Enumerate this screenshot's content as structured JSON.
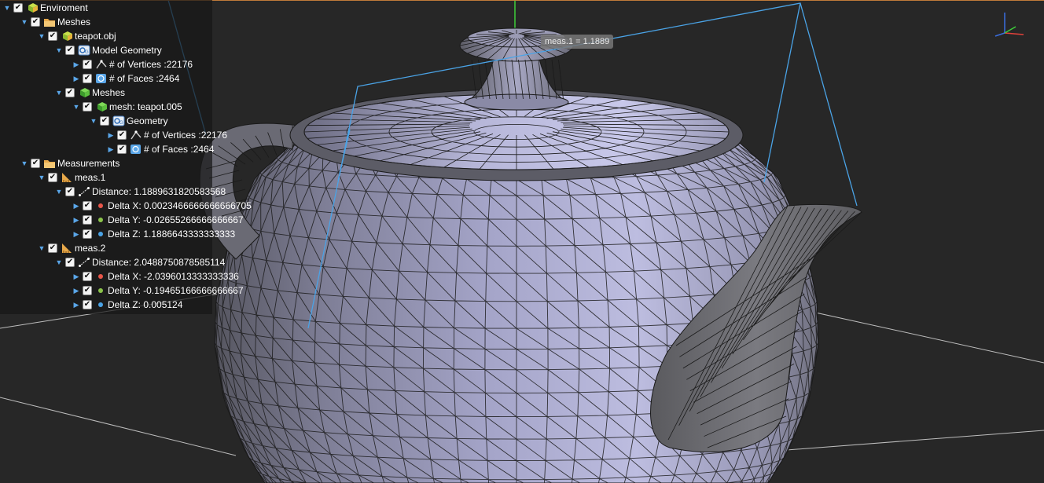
{
  "tree": {
    "items": [
      {
        "label": "Enviroment",
        "icon": "scene-cube-icon",
        "arrow": "open",
        "depth": 0
      },
      {
        "label": "Meshes",
        "icon": "folder-icon",
        "arrow": "open",
        "depth": 1
      },
      {
        "label": "teapot.obj",
        "icon": "scene-cube-icon",
        "arrow": "open",
        "depth": 2
      },
      {
        "label": "Model Geometry",
        "icon": "geometry-icon",
        "arrow": "open",
        "depth": 3
      },
      {
        "label": "# of Vertices :22176",
        "icon": "vertex-icon",
        "arrow": "closed",
        "depth": 4
      },
      {
        "label": "# of Faces :2464",
        "icon": "face-icon",
        "arrow": "closed",
        "depth": 4
      },
      {
        "label": "Meshes",
        "icon": "green-cube-icon",
        "arrow": "open",
        "depth": 3
      },
      {
        "label": "mesh: teapot.005",
        "icon": "green-cube-icon",
        "arrow": "open",
        "depth": 4
      },
      {
        "label": "Geometry",
        "icon": "geometry-icon",
        "arrow": "open",
        "depth": 5
      },
      {
        "label": "# of Vertices :22176",
        "icon": "vertex-icon",
        "arrow": "closed",
        "depth": 6
      },
      {
        "label": "# of Faces :2464",
        "icon": "face-icon",
        "arrow": "closed",
        "depth": 6
      },
      {
        "label": "Measurements",
        "icon": "folder-icon",
        "arrow": "open",
        "depth": 1
      },
      {
        "label": "meas.1",
        "icon": "ruler-icon",
        "arrow": "open",
        "depth": 2
      },
      {
        "label": "Distance: 1.1889631820583568",
        "icon": "distance-icon",
        "arrow": "open",
        "depth": 3
      },
      {
        "label": "Delta X: 0.0023466666666666705",
        "icon": "dot-red",
        "arrow": "closed",
        "depth": 4
      },
      {
        "label": "Delta Y: -0.02655266666666667",
        "icon": "dot-green",
        "arrow": "closed",
        "depth": 4
      },
      {
        "label": "Delta Z: 1.1886643333333333",
        "icon": "dot-blue",
        "arrow": "closed",
        "depth": 4
      },
      {
        "label": "meas.2",
        "icon": "ruler-icon",
        "arrow": "open",
        "depth": 2
      },
      {
        "label": "Distance: 2.0488750878585114",
        "icon": "distance-icon",
        "arrow": "open",
        "depth": 3
      },
      {
        "label": "Delta X: -2.0396013333333336",
        "icon": "dot-red",
        "arrow": "closed",
        "depth": 4
      },
      {
        "label": "Delta Y: -0.19465166666666667",
        "icon": "dot-green",
        "arrow": "closed",
        "depth": 4
      },
      {
        "label": "Delta Z: 0.005124",
        "icon": "dot-blue",
        "arrow": "closed",
        "depth": 4
      }
    ]
  },
  "viewport": {
    "measurement_label": "meas.1 = 1.1889"
  },
  "colors": {
    "teapot_fill": "#a3a3c6",
    "wire": "#1a1a1a",
    "measure_line": "#4aa3e6",
    "floor_line": "#bdbdbd",
    "axis_x": "#e0413a",
    "axis_y": "#3ecf3a",
    "axis_z": "#3a6ee0",
    "dot_red": "#e8564a",
    "dot_green": "#8bc34a",
    "dot_blue": "#4aa3e6"
  }
}
